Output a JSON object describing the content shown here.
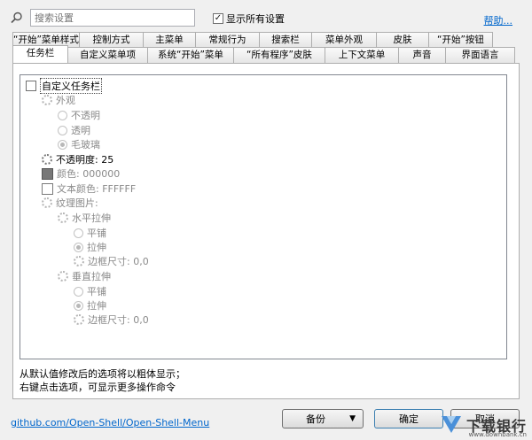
{
  "search": {
    "placeholder": "搜索设置"
  },
  "show_all": {
    "label": "显示所有设置",
    "checked": true
  },
  "help": {
    "label": "帮助..."
  },
  "tabs_row1": [
    "“开始”菜单样式",
    "控制方式",
    "主菜单",
    "常规行为",
    "搜索栏",
    "菜单外观",
    "皮肤",
    "“开始”按钮"
  ],
  "tabs_row2": [
    "任务栏",
    "自定义菜单项",
    "系统“开始”菜单",
    "“所有程序”皮肤",
    "上下文菜单",
    "声音",
    "界面语言"
  ],
  "active_tab": "任务栏",
  "tree": {
    "custom_taskbar": "自定义任务栏",
    "appearance": "外观",
    "opaque": "不透明",
    "transparent": "透明",
    "glass": "毛玻璃",
    "opacity": "不透明度: 25",
    "color": "颜色: 000000",
    "text_color": "文本颜色: FFFFFF",
    "texture": "纹理图片:",
    "h_stretch": "水平拉伸",
    "h_tile": "平铺",
    "h_stretch_opt": "拉伸",
    "h_border": "边框尺寸: 0,0",
    "v_stretch": "垂直拉伸",
    "v_tile": "平铺",
    "v_stretch_opt": "拉伸",
    "v_border": "边框尺寸: 0,0"
  },
  "hints": {
    "line1": "从默认值修改后的选项将以粗体显示；",
    "line2": "右键点击选项，可显示更多操作命令"
  },
  "footer": {
    "link": "github.com/Open-Shell/Open-Shell-Menu",
    "backup": "备份",
    "ok": "确定",
    "cancel": "取消"
  },
  "watermark": {
    "text": "下载银行",
    "sub": "www.downbank.cn"
  },
  "colors": {
    "swatch_color": "#000000",
    "swatch_text": "#FFFFFF",
    "link": "#0066cc"
  }
}
